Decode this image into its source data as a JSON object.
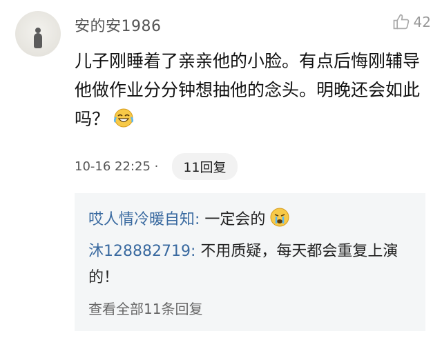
{
  "comment": {
    "username": "安的安1986",
    "likes": "42",
    "text": "儿子刚睡着了亲亲他的小脸。有点后悔刚辅导他做作业分分钟想抽他的念头。明晚还会如此吗？",
    "timestamp": "10-16 22:25 ·",
    "reply_count_label": "11回复",
    "icons": {
      "like": "thumbs-up-icon",
      "emoji": "laugh-cry-emoji"
    }
  },
  "replies": [
    {
      "name": "哎人情冷暖自知:",
      "text": " 一定会的",
      "emoji": "crying-emoji"
    },
    {
      "name": "沐128882719:",
      "text": " 不用质疑，每天都会重复上演的！"
    }
  ],
  "view_all_label": "查看全部11条回复"
}
